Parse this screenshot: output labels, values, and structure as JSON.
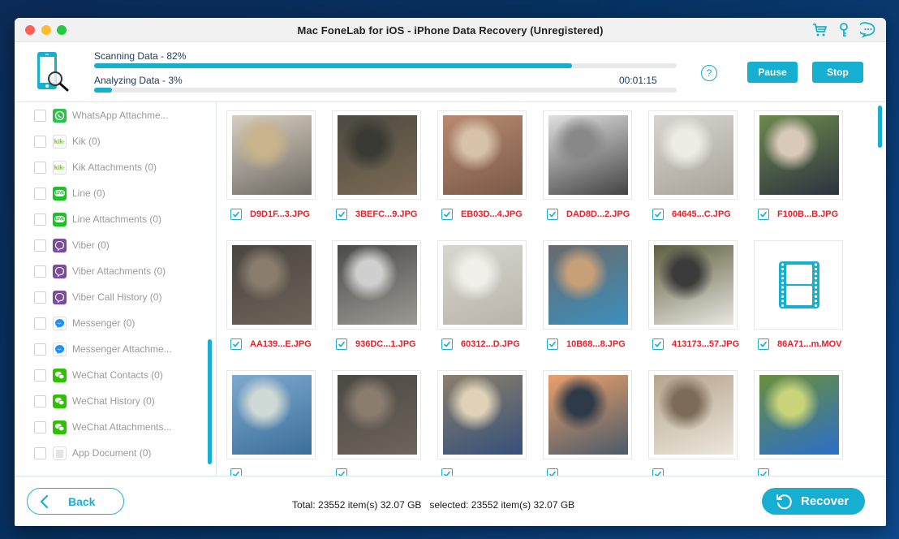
{
  "window": {
    "title": "Mac FoneLab for iOS - iPhone Data Recovery (Unregistered)",
    "title_icons": [
      "cart-icon",
      "key-icon",
      "chat-icon"
    ]
  },
  "progress": {
    "scanning": {
      "label": "Scanning Data - 82%",
      "percent": 82
    },
    "analyzing": {
      "label": "Analyzing Data - 3%",
      "percent": 3
    },
    "elapsed": "00:01:15",
    "help_label": "?",
    "pause_label": "Pause",
    "stop_label": "Stop"
  },
  "sidebar": {
    "items": [
      {
        "label": "WhatsApp Attachme...",
        "icon": "whatsapp-icon",
        "checked": false
      },
      {
        "label": "Kik (0)",
        "icon": "kik-icon",
        "checked": false
      },
      {
        "label": "Kik Attachments (0)",
        "icon": "kik-icon",
        "checked": false
      },
      {
        "label": "Line (0)",
        "icon": "line-icon",
        "checked": false
      },
      {
        "label": "Line Attachments (0)",
        "icon": "line-icon",
        "checked": false
      },
      {
        "label": "Viber (0)",
        "icon": "viber-icon",
        "checked": false
      },
      {
        "label": "Viber Attachments (0)",
        "icon": "viber-icon",
        "checked": false
      },
      {
        "label": "Viber Call History (0)",
        "icon": "viber-icon",
        "checked": false
      },
      {
        "label": "Messenger (0)",
        "icon": "messenger-icon",
        "checked": false
      },
      {
        "label": "Messenger Attachme...",
        "icon": "messenger-icon",
        "checked": false
      },
      {
        "label": "WeChat Contacts (0)",
        "icon": "wechat-icon",
        "checked": false
      },
      {
        "label": "WeChat History (0)",
        "icon": "wechat-icon",
        "checked": false
      },
      {
        "label": "WeChat Attachments...",
        "icon": "wechat-icon",
        "checked": false
      },
      {
        "label": "App Document (0)",
        "icon": "document-icon",
        "checked": false
      }
    ]
  },
  "files": [
    {
      "name": "D9D1F...3.JPG",
      "type": "photo",
      "checked": true
    },
    {
      "name": "3BEFC...9.JPG",
      "type": "photo",
      "checked": true
    },
    {
      "name": "EB03D...4.JPG",
      "type": "photo",
      "checked": true
    },
    {
      "name": "DAD8D...2.JPG",
      "type": "photo",
      "checked": true
    },
    {
      "name": "64645...C.JPG",
      "type": "photo",
      "checked": true
    },
    {
      "name": "F100B...B.JPG",
      "type": "photo",
      "checked": true
    },
    {
      "name": "AA139...E.JPG",
      "type": "photo",
      "checked": true
    },
    {
      "name": "936DC...1.JPG",
      "type": "photo",
      "checked": true
    },
    {
      "name": "60312...D.JPG",
      "type": "photo",
      "checked": true
    },
    {
      "name": "10B68...8.JPG",
      "type": "photo",
      "checked": true
    },
    {
      "name": "413173...57.JPG",
      "type": "photo",
      "checked": true
    },
    {
      "name": "86A71...m.MOV",
      "type": "video",
      "checked": true
    },
    {
      "name": "",
      "type": "photo",
      "checked": true
    },
    {
      "name": "",
      "type": "photo",
      "checked": true
    },
    {
      "name": "",
      "type": "photo",
      "checked": true
    },
    {
      "name": "",
      "type": "photo",
      "checked": true
    },
    {
      "name": "",
      "type": "photo",
      "checked": true
    },
    {
      "name": "",
      "type": "photo",
      "checked": true
    }
  ],
  "footer": {
    "back_label": "Back",
    "totals": "Total: 23552 item(s) 32.07 GB   selected: 23552 item(s) 32.07 GB",
    "recover_label": "Recover"
  },
  "colors": {
    "accent": "#17afd1",
    "filename": "#e8202b",
    "sidebar_text": "#9a9a9a"
  }
}
